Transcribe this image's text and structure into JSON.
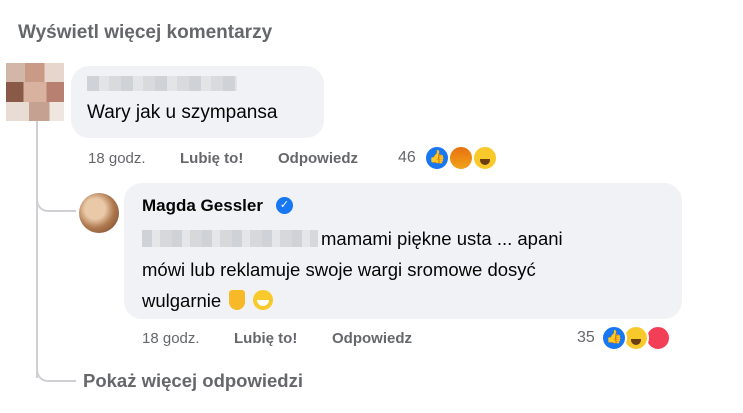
{
  "top_link": "Wyświetl więcej komentarzy",
  "comment1": {
    "text": "Wary jak u szympansa",
    "time": "18 godz.",
    "like": "Lubię to!",
    "reply": "Odpowiedz",
    "reaction_count": "46",
    "reactions": [
      "like-reaction-icon",
      "angry-reaction-icon",
      "haha-reaction-icon"
    ]
  },
  "reply1": {
    "author": "Magda Gessler",
    "verified_icon": "verified-badge-icon",
    "text_line1": "mamami piękne usta ... apani",
    "text_line2": "mówi lub reklamuje swoje wargi sromowe dosyć",
    "text_line3": "wulgarnie",
    "emojis": [
      "thumbs-down-icon",
      "grinning-face-icon"
    ],
    "time": "18 godz.",
    "like": "Lubię to!",
    "reply": "Odpowiedz",
    "reaction_count": "35",
    "reactions": [
      "like-reaction-icon",
      "haha-reaction-icon",
      "love-reaction-icon"
    ]
  },
  "more_replies": "Pokaż więcej odpowiedzi",
  "colors": {
    "link_gray": "#65676b",
    "bubble_bg": "#f0f2f5",
    "like_blue": "#1877f2",
    "love_red": "#f33e58"
  }
}
